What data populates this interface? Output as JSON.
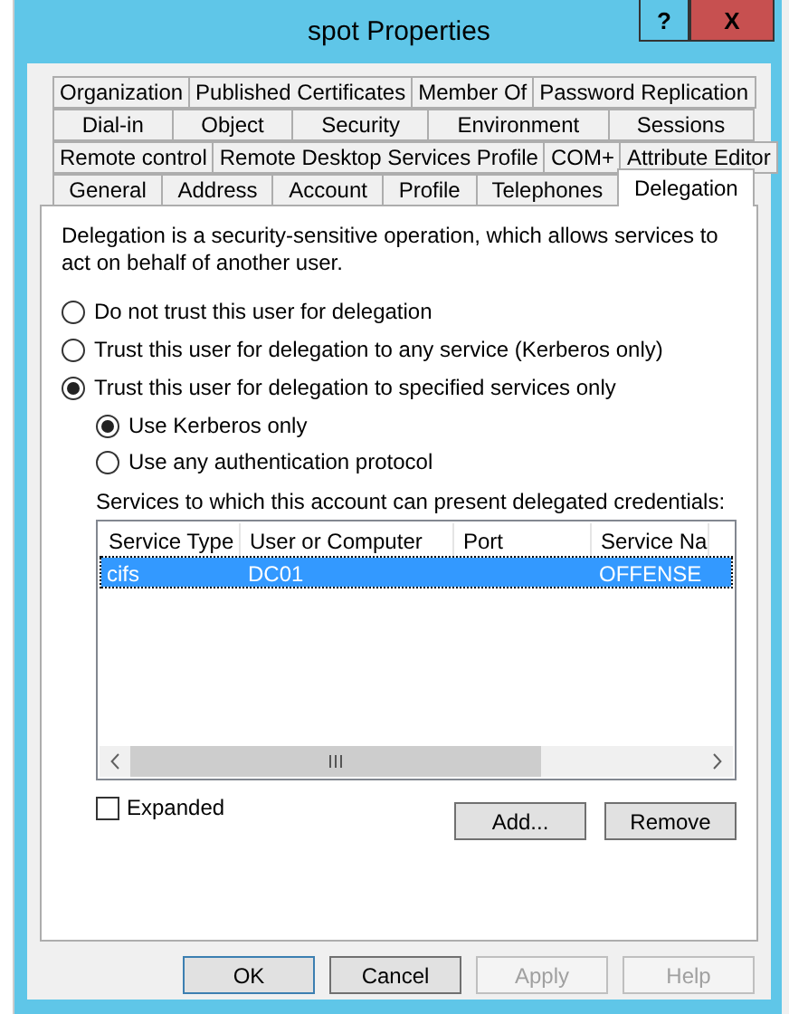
{
  "window": {
    "title": "spot Properties"
  },
  "title_buttons": [
    {
      "label": "?",
      "kind": "help"
    },
    {
      "label": "X",
      "kind": "close"
    }
  ],
  "tab_rows": [
    [
      {
        "label": "Organization",
        "selected": false
      },
      {
        "label": "Published Certificates",
        "selected": false
      },
      {
        "label": "Member Of",
        "selected": false
      },
      {
        "label": "Password Replication",
        "selected": false
      }
    ],
    [
      {
        "label": "Dial-in",
        "selected": false
      },
      {
        "label": "Object",
        "selected": false
      },
      {
        "label": "Security",
        "selected": false
      },
      {
        "label": "Environment",
        "selected": false
      },
      {
        "label": "Sessions",
        "selected": false
      }
    ],
    [
      {
        "label": "Remote control",
        "selected": false
      },
      {
        "label": "Remote Desktop Services Profile",
        "selected": false
      },
      {
        "label": "COM+",
        "selected": false
      },
      {
        "label": "Attribute Editor",
        "selected": false
      }
    ],
    [
      {
        "label": "General",
        "selected": false
      },
      {
        "label": "Address",
        "selected": false
      },
      {
        "label": "Account",
        "selected": false
      },
      {
        "label": "Profile",
        "selected": false
      },
      {
        "label": "Telephones",
        "selected": false
      },
      {
        "label": "Delegation",
        "selected": true
      }
    ]
  ],
  "description": "Delegation is a security-sensitive operation, which allows services to act on behalf of another user.",
  "options": [
    {
      "label": "Do not trust this user for delegation",
      "selected": false
    },
    {
      "label": "Trust this user for delegation to any service (Kerberos only)",
      "selected": false
    },
    {
      "label": "Trust this user for delegation to specified services only",
      "selected": true,
      "children": [
        {
          "label": "Use Kerberos only",
          "selected": true
        },
        {
          "label": "Use any authentication protocol",
          "selected": false
        }
      ]
    }
  ],
  "services": {
    "label": "Services to which this account can present delegated credentials:",
    "columns": [
      "Service Type",
      "User or Computer",
      "Port",
      "Service Na"
    ],
    "rows": [
      {
        "cells": [
          "cifs",
          "DC01",
          "",
          "OFFENSE"
        ],
        "selected": true
      }
    ]
  },
  "expanded": {
    "label": "Expanded",
    "checked": false
  },
  "list_buttons": [
    {
      "label": "Add...",
      "disabled": false
    },
    {
      "label": "Remove",
      "disabled": false
    }
  ],
  "buttons": [
    {
      "label": "OK",
      "disabled": false,
      "default": true
    },
    {
      "label": "Cancel",
      "disabled": false,
      "default": false
    },
    {
      "label": "Apply",
      "disabled": true,
      "default": false
    },
    {
      "label": "Help",
      "disabled": true,
      "default": false
    }
  ]
}
